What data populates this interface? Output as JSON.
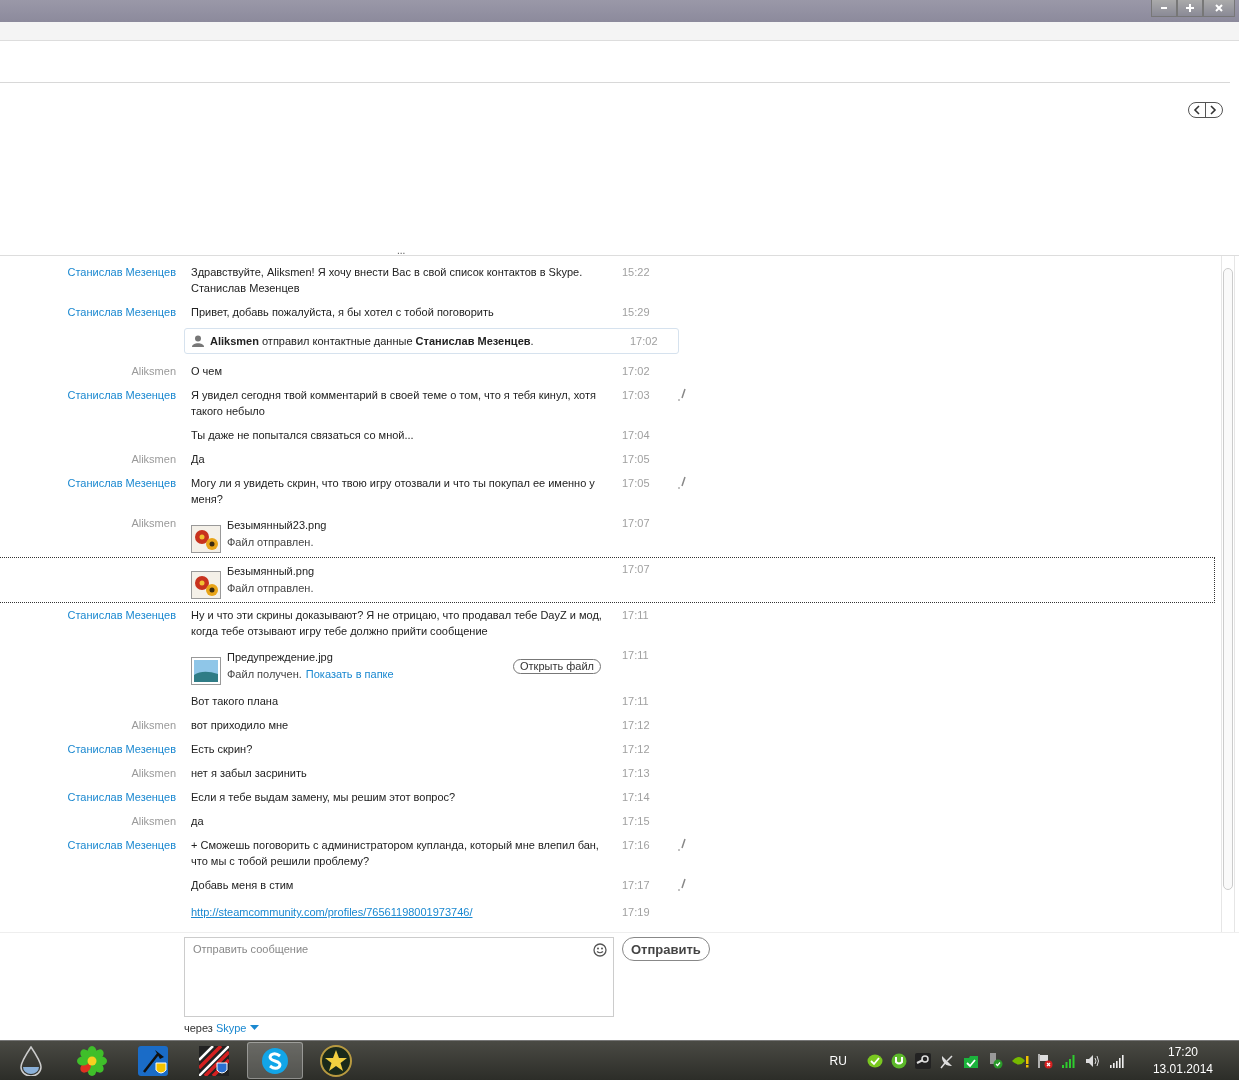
{
  "header": {
    "more": "..."
  },
  "messages": [
    {
      "kind": "text",
      "sender": "Станислав Мезенцев",
      "own": false,
      "text": "Здравствуйте, Aliksmen! Я хочу внести Вас в свой список контактов в Skype.\nСтанислав Мезенцев",
      "time": "15:22",
      "edited": false,
      "selected": false
    },
    {
      "kind": "text",
      "sender": "Станислав Мезенцев",
      "own": false,
      "text": "Привет, добавь пожалуйста, я бы хотел с тобой поговорить",
      "time": "15:29",
      "edited": false,
      "selected": false
    },
    {
      "kind": "contact",
      "text": "**Aliksmen** отправил контактные данные **Станислав Мезенцев**.",
      "time": "17:02",
      "edited": false,
      "selected": false
    },
    {
      "kind": "text",
      "sender": "Aliksmen",
      "own": true,
      "text": "О чем",
      "time": "17:02",
      "edited": false,
      "selected": false
    },
    {
      "kind": "text",
      "sender": "Станислав Мезенцев",
      "own": false,
      "text": "Я увидел сегодня твой комментарий в своей теме о том, что я тебя кинул, хотя такого небыло",
      "time": "17:03",
      "edited": true,
      "selected": false
    },
    {
      "kind": "text",
      "text": "Ты даже не попытался связаться со мной...",
      "time": "17:04",
      "edited": false,
      "selected": false
    },
    {
      "kind": "text",
      "sender": "Aliksmen",
      "own": true,
      "text": "Да",
      "time": "17:05",
      "edited": false,
      "selected": false
    },
    {
      "kind": "text",
      "sender": "Станислав Мезенцев",
      "own": false,
      "text": "Могу ли я увидеть скрин, что твою игру отозвали и что ты покупал ее именно у меня?",
      "time": "17:05",
      "edited": true,
      "selected": false
    },
    {
      "kind": "file",
      "sender": "Aliksmen",
      "own": true,
      "file": {
        "kind": "flower",
        "name": "Безымянный23.png",
        "status": "Файл отправлен."
      },
      "time": "17:07",
      "edited": false,
      "selected": false
    },
    {
      "kind": "file",
      "file": {
        "kind": "flower",
        "name": "Безымянный.png",
        "status": "Файл отправлен."
      },
      "time": "17:07",
      "edited": false,
      "selected": true
    },
    {
      "kind": "text",
      "sender": "Станислав Мезенцев",
      "own": false,
      "text": "Ну и что эти скрины доказывают? Я не отрицаю, что продавал тебе DayZ  и мод, когда тебе отзывают игру тебе должно прийти сообщение",
      "time": "17:11",
      "edited": false,
      "selected": false
    },
    {
      "kind": "file",
      "file": {
        "kind": "landscape",
        "name": "Предупреждение.jpg",
        "status": "Файл получен.",
        "link": "Показать в папке",
        "button": "Открыть файл"
      },
      "time": "17:11",
      "edited": false,
      "selected": false
    },
    {
      "kind": "text",
      "text": "Вот такого плана",
      "time": "17:11",
      "edited": false,
      "selected": false
    },
    {
      "kind": "text",
      "sender": "Aliksmen",
      "own": true,
      "text": "вот приходило мне",
      "time": "17:12",
      "edited": false,
      "selected": false
    },
    {
      "kind": "text",
      "sender": "Станислав Мезенцев",
      "own": false,
      "text": "Есть скрин?",
      "time": "17:12",
      "edited": false,
      "selected": false
    },
    {
      "kind": "text",
      "sender": "Aliksmen",
      "own": true,
      "text": "нет я забыл засринить",
      "time": "17:13",
      "edited": false,
      "selected": false
    },
    {
      "kind": "text",
      "sender": "Станислав Мезенцев",
      "own": false,
      "text": "Если я тебе выдам замену, мы решим этот вопрос?",
      "time": "17:14",
      "edited": false,
      "selected": false
    },
    {
      "kind": "text",
      "sender": "Aliksmen",
      "own": true,
      "text": "да",
      "time": "17:15",
      "edited": false,
      "selected": false
    },
    {
      "kind": "text",
      "sender": "Станислав Мезенцев",
      "own": false,
      "text": "+ Сможешь поговорить с администратором купланда, который мне влепил бан, что мы с тобой решили проблему?",
      "time": "17:16",
      "edited": true,
      "selected": false
    },
    {
      "kind": "text",
      "text": "Добавь меня в стим",
      "time": "17:17",
      "edited": true,
      "selected": false
    },
    {
      "kind": "link",
      "text": "http://steamcommunity.com/profiles/76561198001973746/",
      "time": "17:19",
      "edited": false,
      "selected": false
    }
  ],
  "compose": {
    "placeholder": "Отправить сообщение",
    "send": "Отправить",
    "via": "через",
    "via_link": "Skype"
  },
  "taskbar": {
    "apps": [
      {
        "kind": "drop",
        "selected": false
      },
      {
        "kind": "flower",
        "selected": false
      },
      {
        "kind": "axe",
        "selected": false
      },
      {
        "kind": "stripes",
        "selected": false
      },
      {
        "kind": "skype",
        "selected": true
      },
      {
        "kind": "star",
        "selected": false
      }
    ],
    "language": "RU",
    "time": "17:20",
    "date": "13.01.2014"
  }
}
